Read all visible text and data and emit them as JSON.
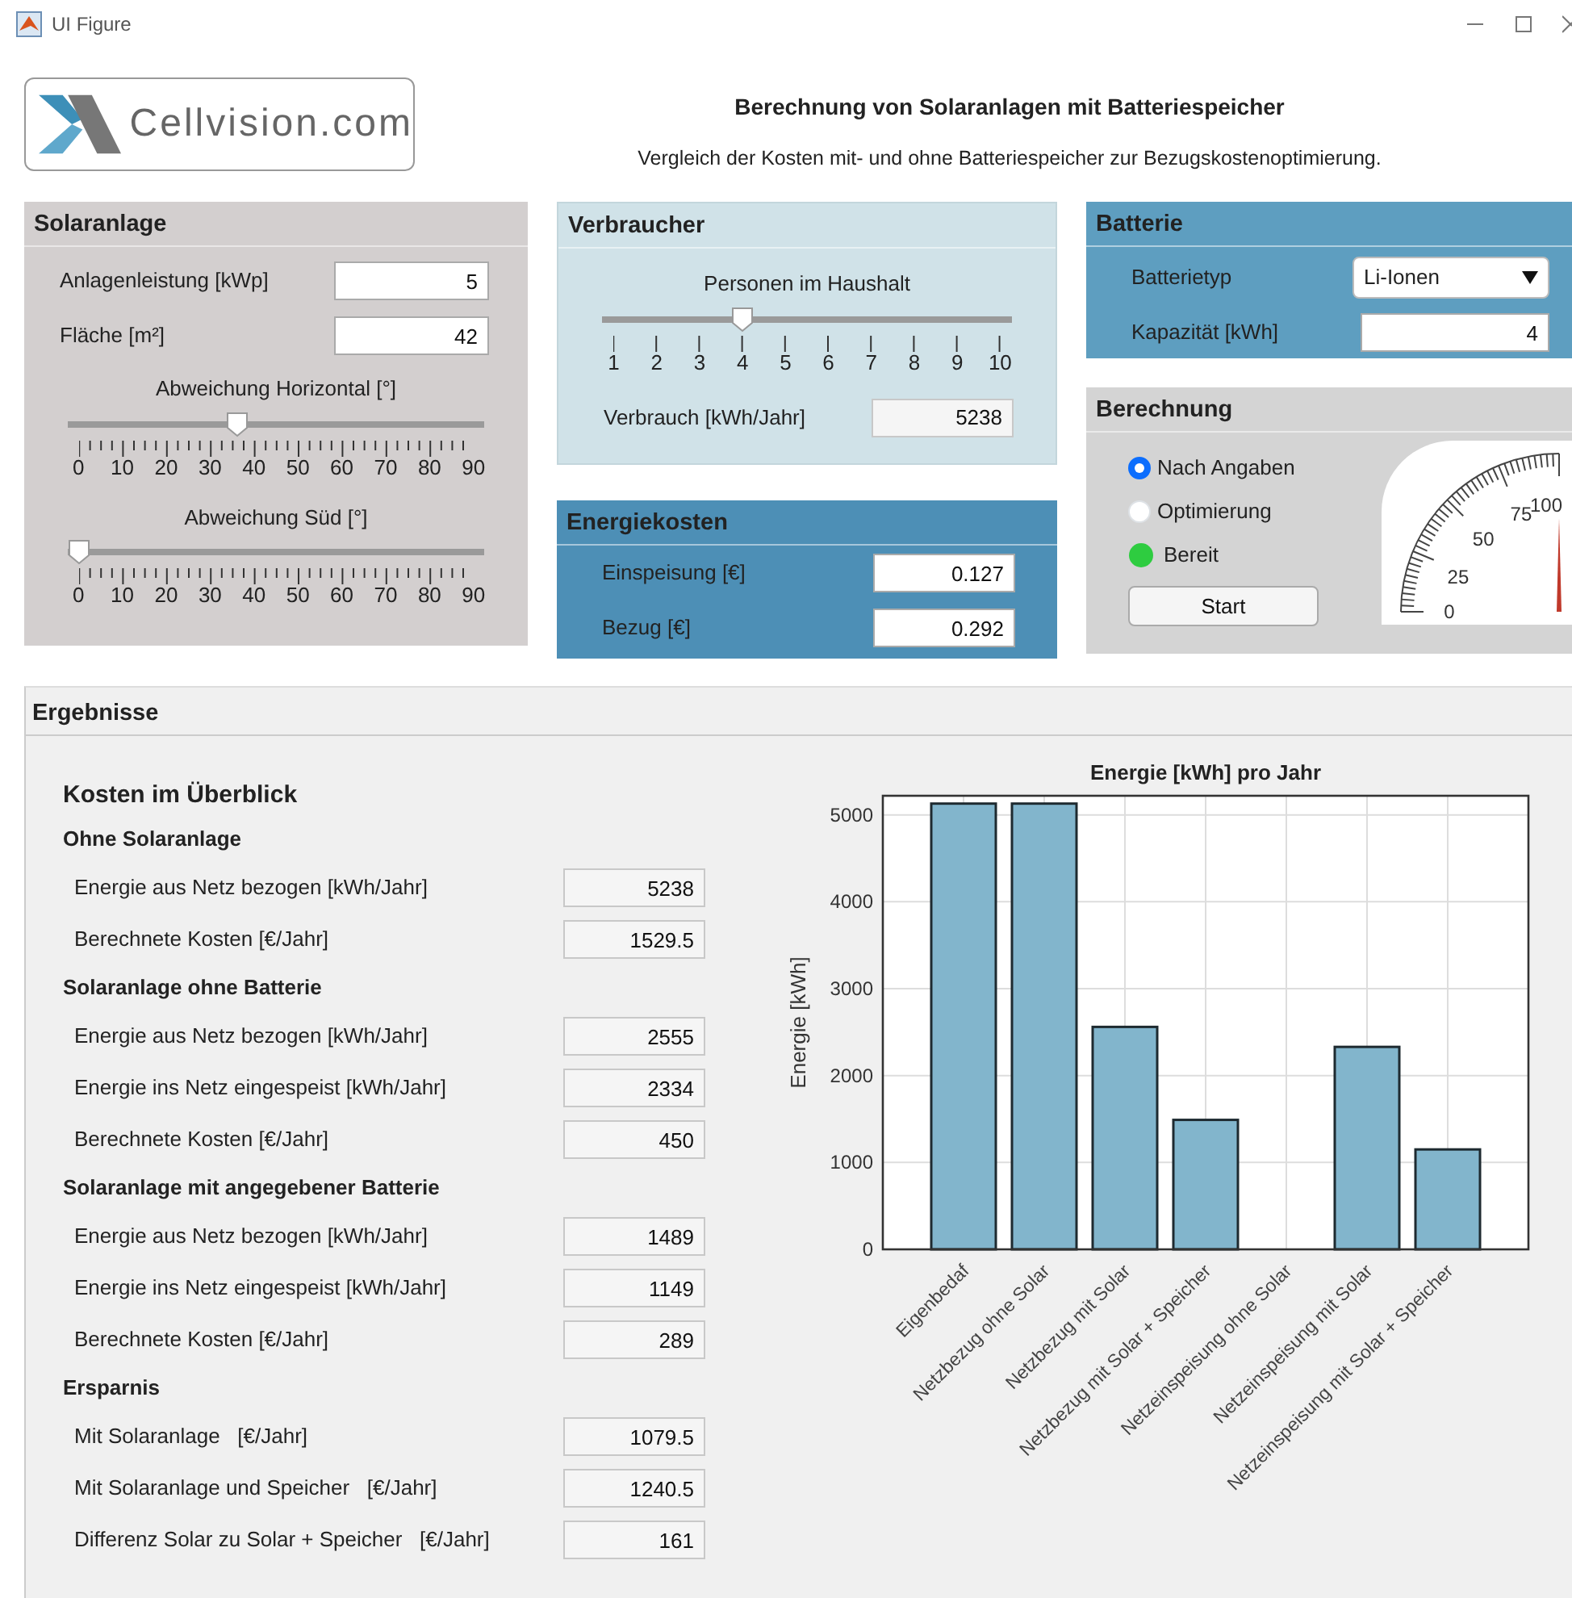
{
  "window": {
    "title": "UI Figure"
  },
  "logo": {
    "text": "Cellvision.com"
  },
  "header": {
    "title": "Berechnung von Solaranlagen mit Batteriespeicher",
    "subtitle": "Vergleich der Kosten mit- und ohne Batteriespeicher zur Bezugskostenoptimierung."
  },
  "solaranlage": {
    "title": "Solaranlage",
    "fields": [
      {
        "label": "Anlagenleistung [kWp]",
        "value": "5"
      },
      {
        "label": "Fläche [m²]",
        "value": "42"
      }
    ],
    "sliders": [
      {
        "label": "Abweichung Horizontal [°]",
        "level": 0.4,
        "ticks": [
          "0",
          "10",
          "20",
          "30",
          "40",
          "50",
          "60",
          "70",
          "80",
          "90"
        ]
      },
      {
        "label": "Abweichung Süd [°]",
        "level": 0,
        "ticks": [
          "0",
          "10",
          "20",
          "30",
          "40",
          "50",
          "60",
          "70",
          "80",
          "90"
        ]
      }
    ]
  },
  "verbraucher": {
    "title": "Verbraucher",
    "slider": {
      "label": "Personen im Haushalt",
      "level": 0.333,
      "ticks": [
        "1",
        "2",
        "3",
        "4",
        "5",
        "6",
        "7",
        "8",
        "9",
        "10"
      ]
    },
    "field": {
      "label": "Verbrauch [kWh/Jahr]",
      "value": "5238"
    }
  },
  "energiekosten": {
    "title": "Energiekosten",
    "fields": [
      {
        "label": "Einspeisung [€]",
        "value": "0.127"
      },
      {
        "label": "Bezug [€]",
        "value": "0.292"
      }
    ]
  },
  "batterie": {
    "title": "Batterie",
    "dropdown": {
      "label": "Batterietyp",
      "value": "Li-Ionen"
    },
    "field": {
      "label": "Kapazität [kWh]",
      "value": "4"
    }
  },
  "berechnung": {
    "title": "Berechnung",
    "options": [
      {
        "label": "Nach Angaben",
        "selected": true
      },
      {
        "label": "Optimierung",
        "selected": false
      }
    ],
    "lamp": {
      "label": "Bereit",
      "color": "#2ecc40"
    },
    "button": "Start",
    "gauge": {
      "ticks": [
        "0",
        "25",
        "50",
        "75",
        "100"
      ]
    }
  },
  "ergebnisse": {
    "title": "Ergebnisse",
    "heading": "Kosten im Überblick",
    "sections": [
      {
        "title": "Ohne Solaranlage",
        "rows": [
          {
            "label": "Energie aus Netz bezogen [kWh/Jahr]",
            "value": "5238"
          },
          {
            "label": "Berechnete Kosten [€/Jahr]",
            "value": "1529.5"
          }
        ]
      },
      {
        "title": "Solaranlage ohne Batterie",
        "rows": [
          {
            "label": "Energie aus Netz bezogen [kWh/Jahr]",
            "value": "2555"
          },
          {
            "label": "Energie ins Netz eingespeist [kWh/Jahr]",
            "value": "2334"
          },
          {
            "label": "Berechnete Kosten [€/Jahr]",
            "value": "450"
          }
        ]
      },
      {
        "title": "Solaranlage mit angegebener Batterie",
        "rows": [
          {
            "label": "Energie aus Netz bezogen [kWh/Jahr]",
            "value": "1489"
          },
          {
            "label": "Energie ins Netz eingespeist [kWh/Jahr]",
            "value": "1149"
          },
          {
            "label": "Berechnete Kosten [€/Jahr]",
            "value": "289"
          }
        ]
      },
      {
        "title": "Ersparnis",
        "rows": [
          {
            "label": "Mit Solaranlage   [€/Jahr]",
            "value": "1079.5"
          },
          {
            "label": "Mit Solaranlage und Speicher   [€/Jahr]",
            "value": "1240.5"
          },
          {
            "label": "Differenz Solar zu Solar + Speicher   [€/Jahr]",
            "value": "161"
          }
        ]
      }
    ],
    "chart_data": {
      "type": "bar",
      "title": "Energie [kWh] pro Jahr",
      "ylabel": "Energie [kWh]",
      "categories": [
        "Eigenbedaf",
        "Netzbezug ohne Solar",
        "Netzbezug mit Solar",
        "Netzbezug mit Solar + Speicher",
        "Netzeinspeisung ohne Solar",
        "Netzeinspeisung mit Solar",
        "Netzeinspeisung mit Solar + Speicher"
      ],
      "values": [
        5130,
        5130,
        2560,
        1490,
        0,
        2330,
        1150
      ],
      "grid": true,
      "ylim": [
        0,
        5220
      ],
      "yticks": [
        0,
        1000,
        2000,
        3000,
        4000,
        5000
      ]
    }
  }
}
